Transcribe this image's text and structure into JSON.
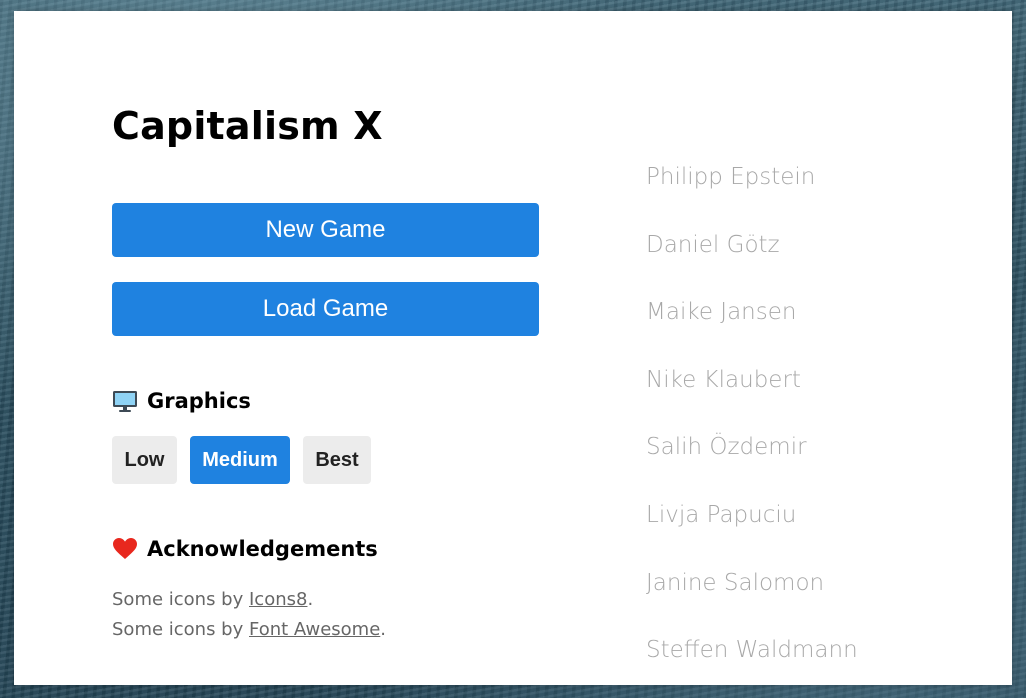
{
  "title": "Capitalism X",
  "menu": {
    "new_game_label": "New Game",
    "load_game_label": "Load Game"
  },
  "graphics": {
    "heading": "Graphics",
    "icon": "monitor-icon",
    "options": [
      "Low",
      "Medium",
      "Best"
    ],
    "selected": "Medium"
  },
  "acknowledgements": {
    "heading": "Acknowledgements",
    "icon": "heart-icon",
    "lines": [
      {
        "prefix": "Some icons by ",
        "link": "Icons8",
        "suffix": "."
      },
      {
        "prefix": "Some icons by ",
        "link": "Font Awesome",
        "suffix": "."
      }
    ]
  },
  "credits": [
    "Philipp Epstein",
    "Daniel Götz",
    "Maike Jansen",
    "Nike Klaubert",
    "Salih Özdemir",
    "Livja Papuciu",
    "Janine Salomon",
    "Steffen Waldmann"
  ],
  "colors": {
    "accent": "#1f82e0",
    "option_inactive": "#ececec",
    "credits_text": "#a8a8a8",
    "heart": "#e8281e"
  }
}
